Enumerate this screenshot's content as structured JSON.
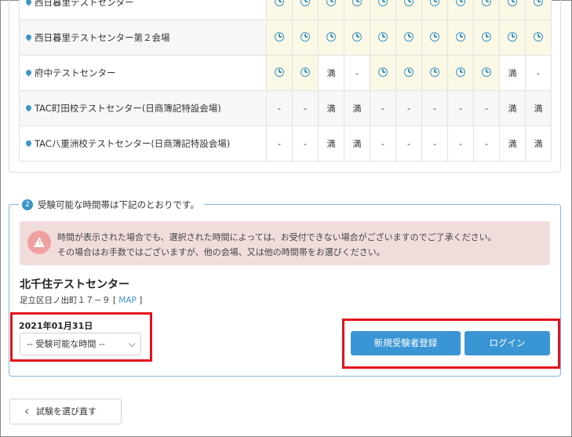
{
  "venues": [
    {
      "name": "西日暮里テストセンター",
      "slots": [
        "open",
        "open",
        "open",
        "open",
        "open",
        "open",
        "open",
        "open",
        "open",
        "open",
        "open"
      ]
    },
    {
      "name": "西日暮里テストセンター第２会場",
      "slots": [
        "open",
        "open",
        "open",
        "open",
        "open",
        "open",
        "open",
        "open",
        "open",
        "open",
        "open"
      ]
    },
    {
      "name": "府中テストセンター",
      "slots": [
        "open",
        "open",
        "満",
        "-",
        "open",
        "open",
        "open",
        "open",
        "open",
        "満",
        "-"
      ]
    },
    {
      "name": "TAC町田校テストセンター(日商簿記特設会場)",
      "slots": [
        "-",
        "-",
        "満",
        "満",
        "-",
        "-",
        "-",
        "-",
        "-",
        "満",
        "満"
      ]
    },
    {
      "name": "TAC八重洲校テストセンター(日商簿記特設会場)",
      "slots": [
        "-",
        "-",
        "満",
        "満",
        "-",
        "-",
        "-",
        "-",
        "-",
        "満",
        "満"
      ]
    }
  ],
  "section2": {
    "step": "2",
    "legend": "受験可能な時間帯は下記のとおりです。",
    "notice_line1": "時間が表示された場合でも、選択された時間によっては、お受付できない場合がございますのでご了承ください。",
    "notice_line2": "その場合はお手数ではございますが、他の会場、又は他の時間帯をお選びください。",
    "venue_title": "北千住テストセンター",
    "address": "足立区日ノ出町１７－９",
    "map_open": "[",
    "map_label": "MAP",
    "map_close": "]",
    "date": "2021年01月31日",
    "time_placeholder": "-- 受験可能な時間 --",
    "register_button": "新規受験者登録",
    "login_button": "ログイン"
  },
  "back_button": "試験を選び直す",
  "colors": {
    "accent": "#3a95d4",
    "highlight": "#e4111b",
    "notice_bg": "#f1dcdc",
    "open_slot_bg": "#fbf8e6"
  }
}
